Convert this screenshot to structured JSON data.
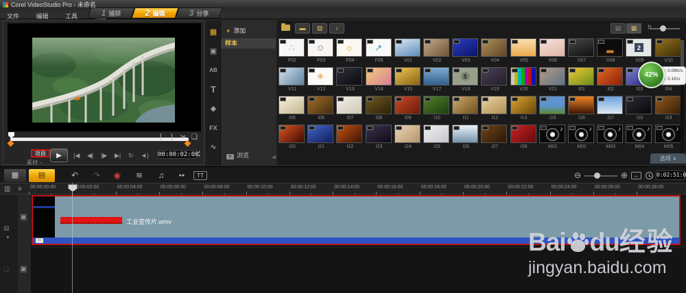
{
  "title_bar": {
    "title": "Corel VideoStudio Pro - 未命名"
  },
  "menu": {
    "items": [
      "文件",
      "编辑",
      "工具",
      "设置"
    ]
  },
  "steps": [
    {
      "num": "1",
      "label": "捕获"
    },
    {
      "num": "2",
      "label": "编辑"
    },
    {
      "num": "3",
      "label": "分享"
    }
  ],
  "preview": {
    "project_label": "项目",
    "clip_label": "素材",
    "timecode": "00:00:02:00"
  },
  "library": {
    "add_label": "添加",
    "sample_label": "样本",
    "browse_label": "浏览",
    "options_label": "选项"
  },
  "gallery": {
    "items": [
      {
        "label": "F02",
        "bg": "#f6f6f4",
        "glyph": "∴",
        "gc": "#9aa4b0"
      },
      {
        "label": "F03",
        "bg": "#f8f6f2",
        "glyph": "☺",
        "gc": "#b070b8"
      },
      {
        "label": "F04",
        "bg": "#faf8f0",
        "glyph": "☼",
        "gc": "#e0a828"
      },
      {
        "label": "F05",
        "bg": "#f8f8f6",
        "glyph": "↗",
        "gc": "#2f9ab0"
      },
      {
        "label": "V01",
        "bg": "linear-gradient(160deg,#d9e7f3,#5e8cba)"
      },
      {
        "label": "V02",
        "bg": "linear-gradient(140deg,#c5ab8c,#6f5335)"
      },
      {
        "label": "V03",
        "bg": "linear-gradient(150deg,#2b3dc0,#0a1468)"
      },
      {
        "label": "V04",
        "bg": "linear-gradient(140deg,#b08f5c,#5f4524)"
      },
      {
        "label": "V05",
        "bg": "linear-gradient(180deg,#f7e0b2,#eba94e)"
      },
      {
        "label": "V06",
        "bg": "linear-gradient(160deg,#f5e0d8,#e0b4a8)"
      },
      {
        "label": "V07",
        "bg": "linear-gradient(160deg,#474747,#101010)"
      },
      {
        "label": "V08",
        "bg": "linear-gradient(180deg,#0c0c0c 70%,#1a1208)",
        "glyph": "▂",
        "gc": "#d08030"
      },
      {
        "label": "V09",
        "bg": "#e6e6e6",
        "glyph": "2",
        "gc": "#ffffff",
        "gbg": "#3a4a5a"
      },
      {
        "label": "V10",
        "bg": "linear-gradient(150deg,#96731c,#3c2d08)"
      },
      {
        "label": "V11",
        "bg": "linear-gradient(135deg,#d4e2ec,#5e82a0)"
      },
      {
        "label": "V12",
        "bg": "#fbfaf7",
        "glyph": "✳",
        "gc": "#d89030"
      },
      {
        "label": "V13",
        "bg": "linear-gradient(150deg,#30303a,#0a0a0e)"
      },
      {
        "label": "V14",
        "bg": "linear-gradient(140deg,#f2cc74,#d87e9a)"
      },
      {
        "label": "V15",
        "bg": "linear-gradient(150deg,#ecc654,#8a6212)"
      },
      {
        "label": "V17",
        "bg": "linear-gradient(180deg,#7fabd0,#2f5f8e)"
      },
      {
        "label": "V18",
        "bg": "#98a08c",
        "glyph": "5",
        "gc": "#222222",
        "gbg": "#7e8670",
        "round": true
      },
      {
        "label": "V19",
        "bg": "linear-gradient(150deg,#4c4256,#221c2a)"
      },
      {
        "label": "V20",
        "bg": "linear-gradient(90deg,#c8c8c8 0 14%,#c8b400 14% 28%,#00b4b4 28% 42%,#00b400 42% 56%,#b400b4 56% 70%,#c01010 70% 84%,#1010b4 84% 100%)"
      },
      {
        "label": "V21",
        "bg": "linear-gradient(140deg,#b49a82,#5e7488)"
      },
      {
        "label": "I01",
        "bg": "linear-gradient(150deg,#eec832,#6e8e1a)"
      },
      {
        "label": "I02",
        "bg": "linear-gradient(140deg,#e66a22,#8a1e08)"
      },
      {
        "label": "I03",
        "bg": "linear-gradient(150deg,#8282cc,#26268a)"
      },
      {
        "label": "I04",
        "bg": "linear-gradient(160deg,#6f9e52,#2a5726)"
      },
      {
        "label": "I05",
        "bg": "linear-gradient(150deg,#f6f0e0,#c6b68e)"
      },
      {
        "label": "I06",
        "bg": "linear-gradient(140deg,#a06e2a,#472c0e)"
      },
      {
        "label": "I07",
        "bg": "linear-gradient(150deg,#f3f0e8,#cdc6b6)"
      },
      {
        "label": "I08",
        "bg": "linear-gradient(150deg,#6e5922,#2c2108)"
      },
      {
        "label": "I09",
        "bg": "linear-gradient(140deg,#c64c2a,#6e1806)"
      },
      {
        "label": "I10",
        "bg": "linear-gradient(150deg,#527e2a,#1e3e0e)"
      },
      {
        "label": "I11",
        "bg": "linear-gradient(140deg,#cbaa6a,#6e4f1e)"
      },
      {
        "label": "I12",
        "bg": "linear-gradient(150deg,#ecd4a4,#ae8d54)"
      },
      {
        "label": "I13",
        "bg": "linear-gradient(140deg,#dca434,#684808)"
      },
      {
        "label": "I15",
        "bg": "linear-gradient(180deg,#5e93ce 55%,#5a8a32)"
      },
      {
        "label": "I16",
        "bg": "linear-gradient(180deg,#ee8422,#3c1606)"
      },
      {
        "label": "I17",
        "bg": "linear-gradient(180deg,#6aa2de,#dfe9f2)"
      },
      {
        "label": "I18",
        "bg": "linear-gradient(150deg,#2e2e3a,#060608)"
      },
      {
        "label": "I19",
        "bg": "linear-gradient(140deg,#90591f,#371e07)"
      },
      {
        "label": "I20",
        "bg": "linear-gradient(140deg,#de5420,#3c0a04)"
      },
      {
        "label": "I21",
        "bg": "linear-gradient(150deg,#4464c4,#0e1e5e)"
      },
      {
        "label": "I22",
        "bg": "linear-gradient(140deg,#c65410,#3c1206)"
      },
      {
        "label": "I23",
        "bg": "linear-gradient(150deg,#3e3450,#0e0a16)"
      },
      {
        "label": "I24",
        "bg": "linear-gradient(140deg,#ecd6b4,#b4946e)"
      },
      {
        "label": "I25",
        "bg": "linear-gradient(150deg,#f2f2f4,#c4c4cc)"
      },
      {
        "label": "I26",
        "bg": "linear-gradient(180deg,#eaf1f8,#7494ac)"
      },
      {
        "label": "I27",
        "bg": "linear-gradient(140deg,#6e4418,#2a1806)"
      },
      {
        "label": "I28",
        "bg": "linear-gradient(140deg,#ca2424,#640a0a)"
      },
      {
        "label": "M01",
        "music": true
      },
      {
        "label": "M02",
        "music": true
      },
      {
        "label": "M03",
        "music": true
      },
      {
        "label": "M04",
        "music": true
      },
      {
        "label": "M05",
        "music": true
      }
    ]
  },
  "timeline": {
    "ruler_ticks": [
      "00:00:00:00",
      "00:00:02:00",
      "00:00:04:00",
      "00:00:06:00",
      "00:00:08:00",
      "00:00:10:00",
      "00:00:12:00",
      "00:00:14:00",
      "00:00:16:00",
      "00:00:18:00",
      "00:00:20:00",
      "00:00:22:00",
      "00:00:24:00",
      "00:00:26:00",
      "00:00:28:00"
    ],
    "duration": "0:02:51:01",
    "clip_name": "工业宣传片.wmv"
  },
  "overlay": {
    "percent": "42%",
    "upload": "0.06K/s",
    "download": "0.1K/s"
  },
  "watermark": {
    "brand_prefix": "Bai",
    "brand_suffix": "du",
    "brand_cn": "经验",
    "url": "jingyan.baidu.com"
  },
  "icons": {
    "add": "+",
    "media": "▦",
    "instant_project": "▣",
    "transition": "AB",
    "title": "T",
    "graphic": "◆",
    "filter": "FX",
    "path": "∿",
    "browse_arrow": "▾",
    "filter_video": "▬",
    "filter_photo": "▨",
    "filter_audio": "♪",
    "view_list": "▤",
    "view_grid": "▦",
    "sort": "⇅",
    "collapse": "«",
    "options_chevron": "∧",
    "mark_in": "[",
    "mark_out": "]",
    "cut": "✂",
    "duplicate": "❏",
    "play": "▶",
    "home": "|◀",
    "step_back": "◀|",
    "step_fwd": "|▶",
    "end": "▶|",
    "repeat": "↻",
    "volume": "◄)",
    "spin_up": "▴",
    "spin_down": "▾",
    "storyboard": "▦",
    "timeline_view": "▤",
    "undo": "↶",
    "redo": "↷",
    "record": "◉",
    "mixer": "≋",
    "auto_music": "♫",
    "batch": "●●",
    "title_track": "TT",
    "zoom_out": "⊖",
    "zoom_in": "⊕",
    "fit": "↔",
    "film_list": "▥",
    "burger": "≡",
    "track_video": "▣",
    "gutter_list": "▤",
    "gutter_arrow": "▼",
    "ripple": "❏",
    "clip_badge": "▭",
    "note": "♪",
    "up_arrow": "↑",
    "down_arrow": "↓",
    "dots": "·····"
  },
  "colors": {
    "accent_yellow": "#f2a500",
    "annotation_red": "#c41212",
    "clip_teal": "#7c9aa8",
    "track_blue": "#2e52c2"
  }
}
